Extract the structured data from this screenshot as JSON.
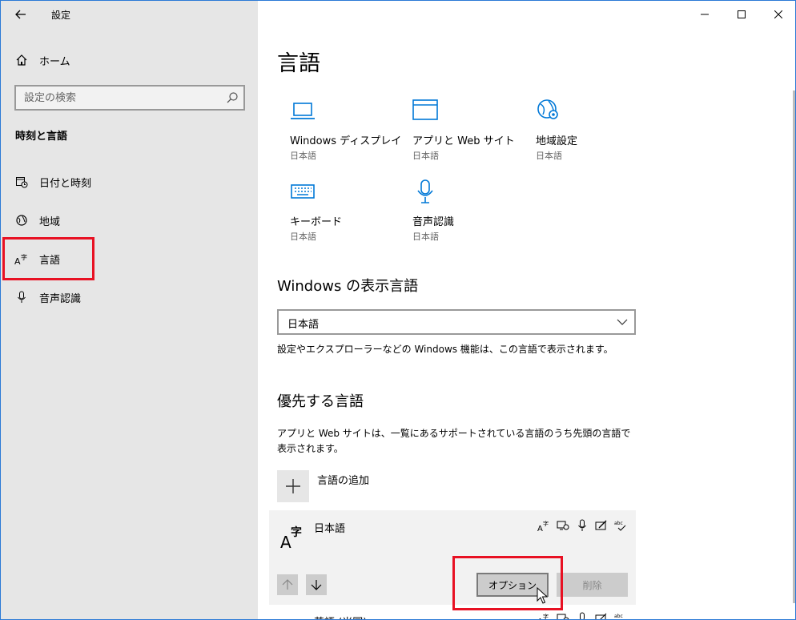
{
  "window": {
    "title": "設定"
  },
  "sidebar": {
    "home_label": "ホーム",
    "search": {
      "placeholder": "設定の検索",
      "value": ""
    },
    "section_title": "時刻と言語",
    "items": [
      {
        "label": "日付と時刻",
        "icon": "calendar-clock-icon"
      },
      {
        "label": "地域",
        "icon": "globe-icon"
      },
      {
        "label": "言語",
        "icon": "language-icon",
        "selected": true
      },
      {
        "label": "音声認識",
        "icon": "microphone-icon"
      }
    ]
  },
  "main": {
    "title": "言語",
    "tiles": [
      {
        "name": "Windows ディスプレイ",
        "sub": "日本語",
        "icon": "laptop-icon"
      },
      {
        "name": "アプリと Web サイト",
        "sub": "日本語",
        "icon": "browser-window-icon"
      },
      {
        "name": "地域設定",
        "sub": "日本語",
        "icon": "globe-settings-icon"
      },
      {
        "name": "キーボード",
        "sub": "日本語",
        "icon": "keyboard-icon"
      },
      {
        "name": "音声認識",
        "sub": "日本語",
        "icon": "microphone-icon"
      }
    ],
    "display_language": {
      "heading": "Windows の表示言語",
      "selected": "日本語",
      "description": "設定やエクスプローラーなどの Windows 機能は、この言語で表示されます。"
    },
    "preferred": {
      "heading": "優先する言語",
      "description": "アプリと Web サイトは、一覧にあるサポートされている言語のうち先頭の言語で表示されます。",
      "add_label": "言語の追加",
      "languages": [
        {
          "name": "日本語",
          "options_label": "オプション",
          "remove_label": "削除"
        },
        {
          "name": "英語 (米国)"
        }
      ]
    }
  },
  "colors": {
    "highlight_box": "#e81123",
    "sidebar_bg": "#e6e6e6",
    "accent": "#0078d7"
  }
}
